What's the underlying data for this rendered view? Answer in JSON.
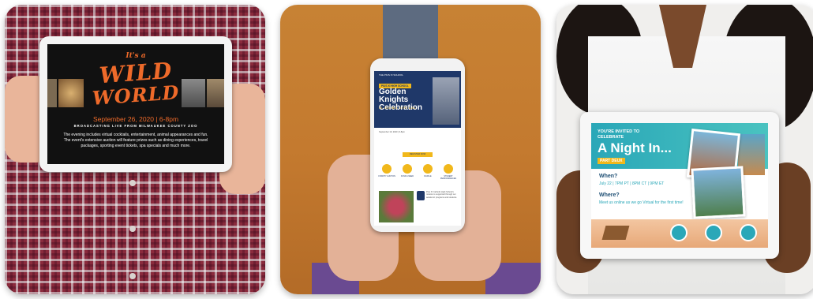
{
  "panel1": {
    "title_top": "It's a",
    "title_mid": "WILD",
    "title_bottom": "WORLD",
    "date": "September 26, 2020 | 6-8pm",
    "subtitle": "BROADCASTING LIVE FROM MILWAUKEE COUNTY ZOO",
    "body": "The evening includes virtual cocktails, entertainment, animal appearances and fun. The event's extensive auction will feature prizes such as dining experiences, travel packages, sporting event tickets, spa specials and much more."
  },
  "panel2": {
    "seal": "THE PIUS XI SCHOOL",
    "tag": "PIUS XI HIGH SCHOOL",
    "title": "Golden Knights Celebration",
    "virtual": "IS GOING VIRTUAL",
    "body": "September 19, 2020 | 6-8pm",
    "button": "REGISTER NOW",
    "icons": [
      "CHARITY AUCTION",
      "FUND A NEED",
      "RAFFLE",
      "STUDENT PERFORMANCES"
    ],
    "body2": "Pius XI Catholic High School's mission is supported through our academic programs and students."
  },
  "panel3": {
    "invite": "YOU'RE INVITED TO CELEBRATE",
    "title": "A Night In...",
    "tag": "PART DEUX",
    "when_label": "When?",
    "when_value": "July 22 | 7PM PT | 8PM CT | 9PM ET",
    "where_label": "Where?",
    "where_value": "Meet us online as we go Virtual for the first time!"
  }
}
